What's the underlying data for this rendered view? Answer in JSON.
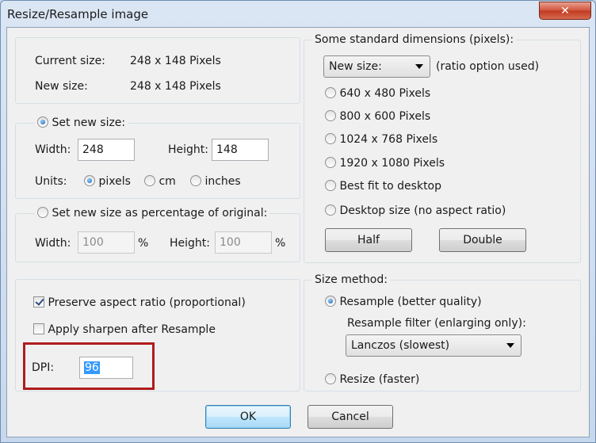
{
  "window": {
    "title": "Resize/Resample image",
    "close_symbol": "✕"
  },
  "sizes": {
    "current_label": "Current size:",
    "current_value": "248  x  148  Pixels",
    "new_label": "New size:",
    "new_value": "248  x  148  Pixels"
  },
  "set_new_size": {
    "legend": "Set new size:",
    "selected": true,
    "width_label": "Width:",
    "width_value": "248",
    "height_label": "Height:",
    "height_value": "148",
    "units_label": "Units:",
    "units": [
      {
        "label": "pixels",
        "selected": true
      },
      {
        "label": "cm",
        "selected": false
      },
      {
        "label": "inches",
        "selected": false
      }
    ]
  },
  "percentage": {
    "legend": "Set new size as percentage of original:",
    "selected": false,
    "width_label": "Width:",
    "width_value": "100",
    "width_unit": "%",
    "height_label": "Height:",
    "height_value": "100",
    "height_unit": "%"
  },
  "standard": {
    "legend": "Some standard dimensions (pixels):",
    "dropdown_value": "New size:",
    "ratio_note": "(ratio option used)",
    "options": [
      "640 x 480 Pixels",
      "800 x 600 Pixels",
      "1024 x 768 Pixels",
      "1920 x 1080 Pixels",
      "Best fit to desktop",
      "Desktop size (no aspect ratio)"
    ],
    "half_label": "Half",
    "double_label": "Double"
  },
  "options": {
    "preserve_label": "Preserve aspect ratio (proportional)",
    "preserve_checked": true,
    "sharpen_label": "Apply sharpen after Resample",
    "sharpen_checked": false,
    "dpi_label": "DPI:",
    "dpi_value": "96"
  },
  "size_method": {
    "legend": "Size method:",
    "resample_label": "Resample (better quality)",
    "resample_selected": true,
    "filter_label": "Resample filter (enlarging only):",
    "filter_value": "Lanczos (slowest)",
    "resize_label": "Resize (faster)",
    "resize_selected": false
  },
  "footer": {
    "ok_label": "OK",
    "cancel_label": "Cancel"
  },
  "colors": {
    "highlight_border": "#b01c1c",
    "title_close": "#c23a20"
  }
}
